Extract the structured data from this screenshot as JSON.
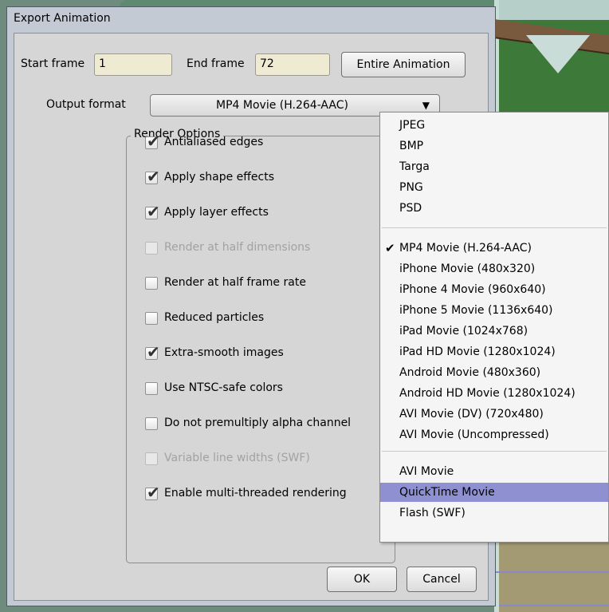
{
  "window": {
    "title": "Export Animation"
  },
  "frames": {
    "start_label": "Start frame",
    "start_value": "1",
    "end_label": "End frame",
    "end_value": "72",
    "entire_button": "Entire Animation"
  },
  "output": {
    "label": "Output format",
    "selected": "MP4 Movie (H.264-AAC)"
  },
  "render_options": {
    "title": "Render Options",
    "items": [
      {
        "label": "Antialiased edges",
        "checked": true,
        "enabled": true
      },
      {
        "label": "Apply shape effects",
        "checked": true,
        "enabled": true
      },
      {
        "label": "Apply layer effects",
        "checked": true,
        "enabled": true
      },
      {
        "label": "Render at half dimensions",
        "checked": false,
        "enabled": false
      },
      {
        "label": "Render at half frame rate",
        "checked": false,
        "enabled": true
      },
      {
        "label": "Reduced particles",
        "checked": false,
        "enabled": true
      },
      {
        "label": "Extra-smooth images",
        "checked": true,
        "enabled": true
      },
      {
        "label": "Use NTSC-safe colors",
        "checked": false,
        "enabled": true
      },
      {
        "label": "Do not premultiply alpha channel",
        "checked": false,
        "enabled": true
      },
      {
        "label": "Variable line widths (SWF)",
        "checked": false,
        "enabled": false
      },
      {
        "label": "Enable multi-threaded rendering",
        "checked": true,
        "enabled": true
      }
    ]
  },
  "buttons": {
    "ok": "OK",
    "cancel": "Cancel"
  },
  "dropdown": {
    "group1": [
      "JPEG",
      "BMP",
      "Targa",
      "PNG",
      "PSD"
    ],
    "group2": [
      "MP4 Movie (H.264-AAC)",
      "iPhone Movie (480x320)",
      "iPhone 4 Movie (960x640)",
      "iPhone 5 Movie (1136x640)",
      "iPad Movie (1024x768)",
      "iPad HD Movie (1280x1024)",
      "Android Movie (480x360)",
      "Android HD Movie (1280x1024)",
      "AVI Movie (DV) (720x480)",
      "AVI Movie (Uncompressed)"
    ],
    "group3": [
      "AVI Movie",
      "QuickTime Movie",
      "Flash (SWF)"
    ],
    "checked_item": "MP4 Movie (H.264-AAC)",
    "highlighted_item": "QuickTime Movie",
    "check_glyph": "✔"
  },
  "colors": {
    "highlight": "#8e90d2",
    "dialog_bg": "#d6d6d6",
    "field_bg": "#efebd2"
  }
}
